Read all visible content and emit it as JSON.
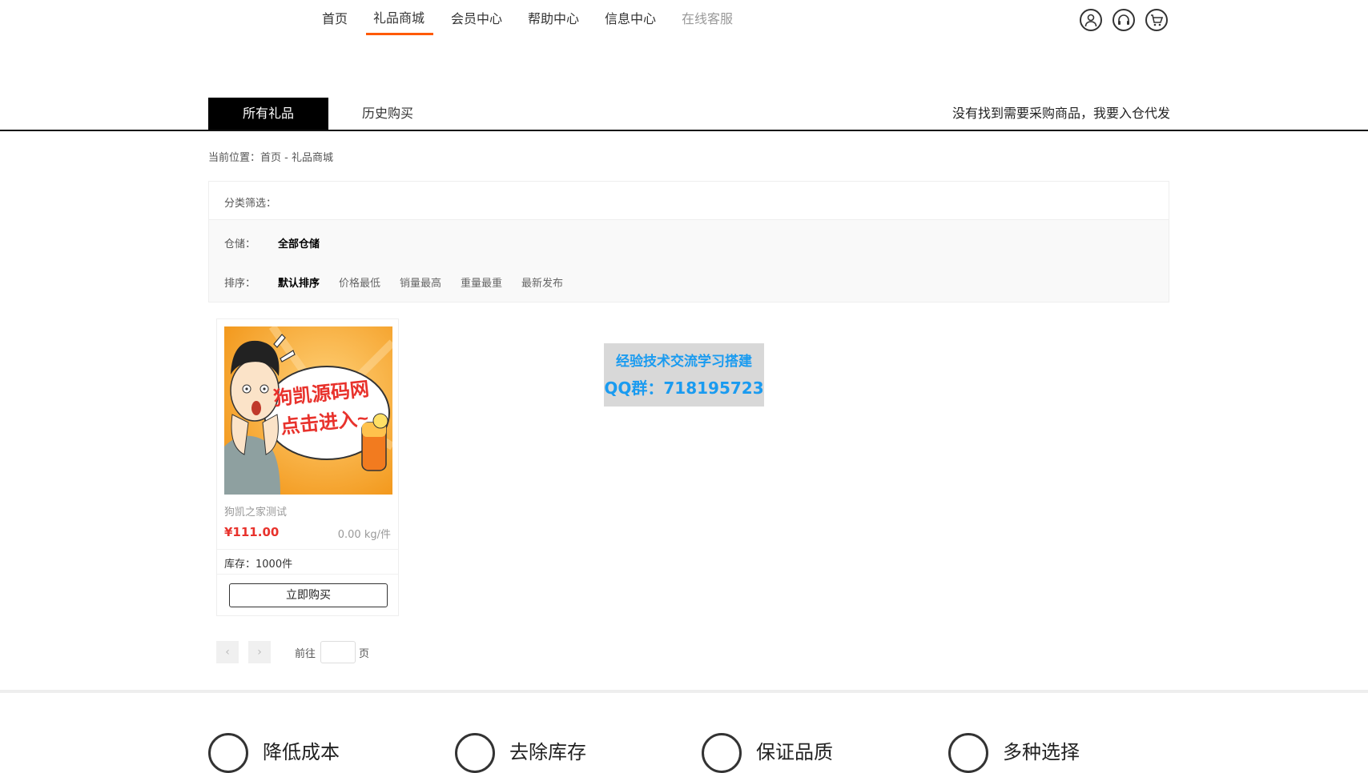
{
  "nav": {
    "items": [
      {
        "label": "首页"
      },
      {
        "label": "礼品商城"
      },
      {
        "label": "会员中心"
      },
      {
        "label": "帮助中心"
      },
      {
        "label": "信息中心"
      },
      {
        "label": "在线客服"
      }
    ],
    "icons": [
      "user-icon",
      "headset-icon",
      "cart-icon"
    ]
  },
  "tabs": {
    "all": "所有礼品",
    "history": "历史购买",
    "right_link": "没有找到需要采购商品，我要入仓代发"
  },
  "breadcrumb": {
    "prefix": "当前位置：",
    "home": "首页",
    "sep": " - ",
    "current": "礼品商城"
  },
  "filter": {
    "category_label": "分类筛选：",
    "warehouse_label": "仓储：",
    "warehouse_value": "全部仓储",
    "sort_label": "排序：",
    "sort_options": [
      "默认排序",
      "价格最低",
      "销量最高",
      "重量最重",
      "最新发布"
    ]
  },
  "product": {
    "image_text_1": "狗凯源码网",
    "image_text_2": "点击进入~",
    "name": "狗凯之家测试",
    "price": "¥111.00",
    "weight": "0.00 kg/件",
    "stock": "库存：1000件",
    "buy": "立即购买"
  },
  "watermark": {
    "line1": "经验技术交流学习搭建",
    "line2": "QQ群：718195723"
  },
  "pagination": {
    "prev": "‹",
    "next": "›",
    "goto_label": "前往",
    "page_unit": "页"
  },
  "footer": {
    "features": [
      "降低成本",
      "去除库存",
      "保证品质",
      "多种选择"
    ]
  },
  "colors": {
    "accent": "#ff5a00",
    "price": "#e8322c",
    "watermark": "#1a9bf0"
  }
}
